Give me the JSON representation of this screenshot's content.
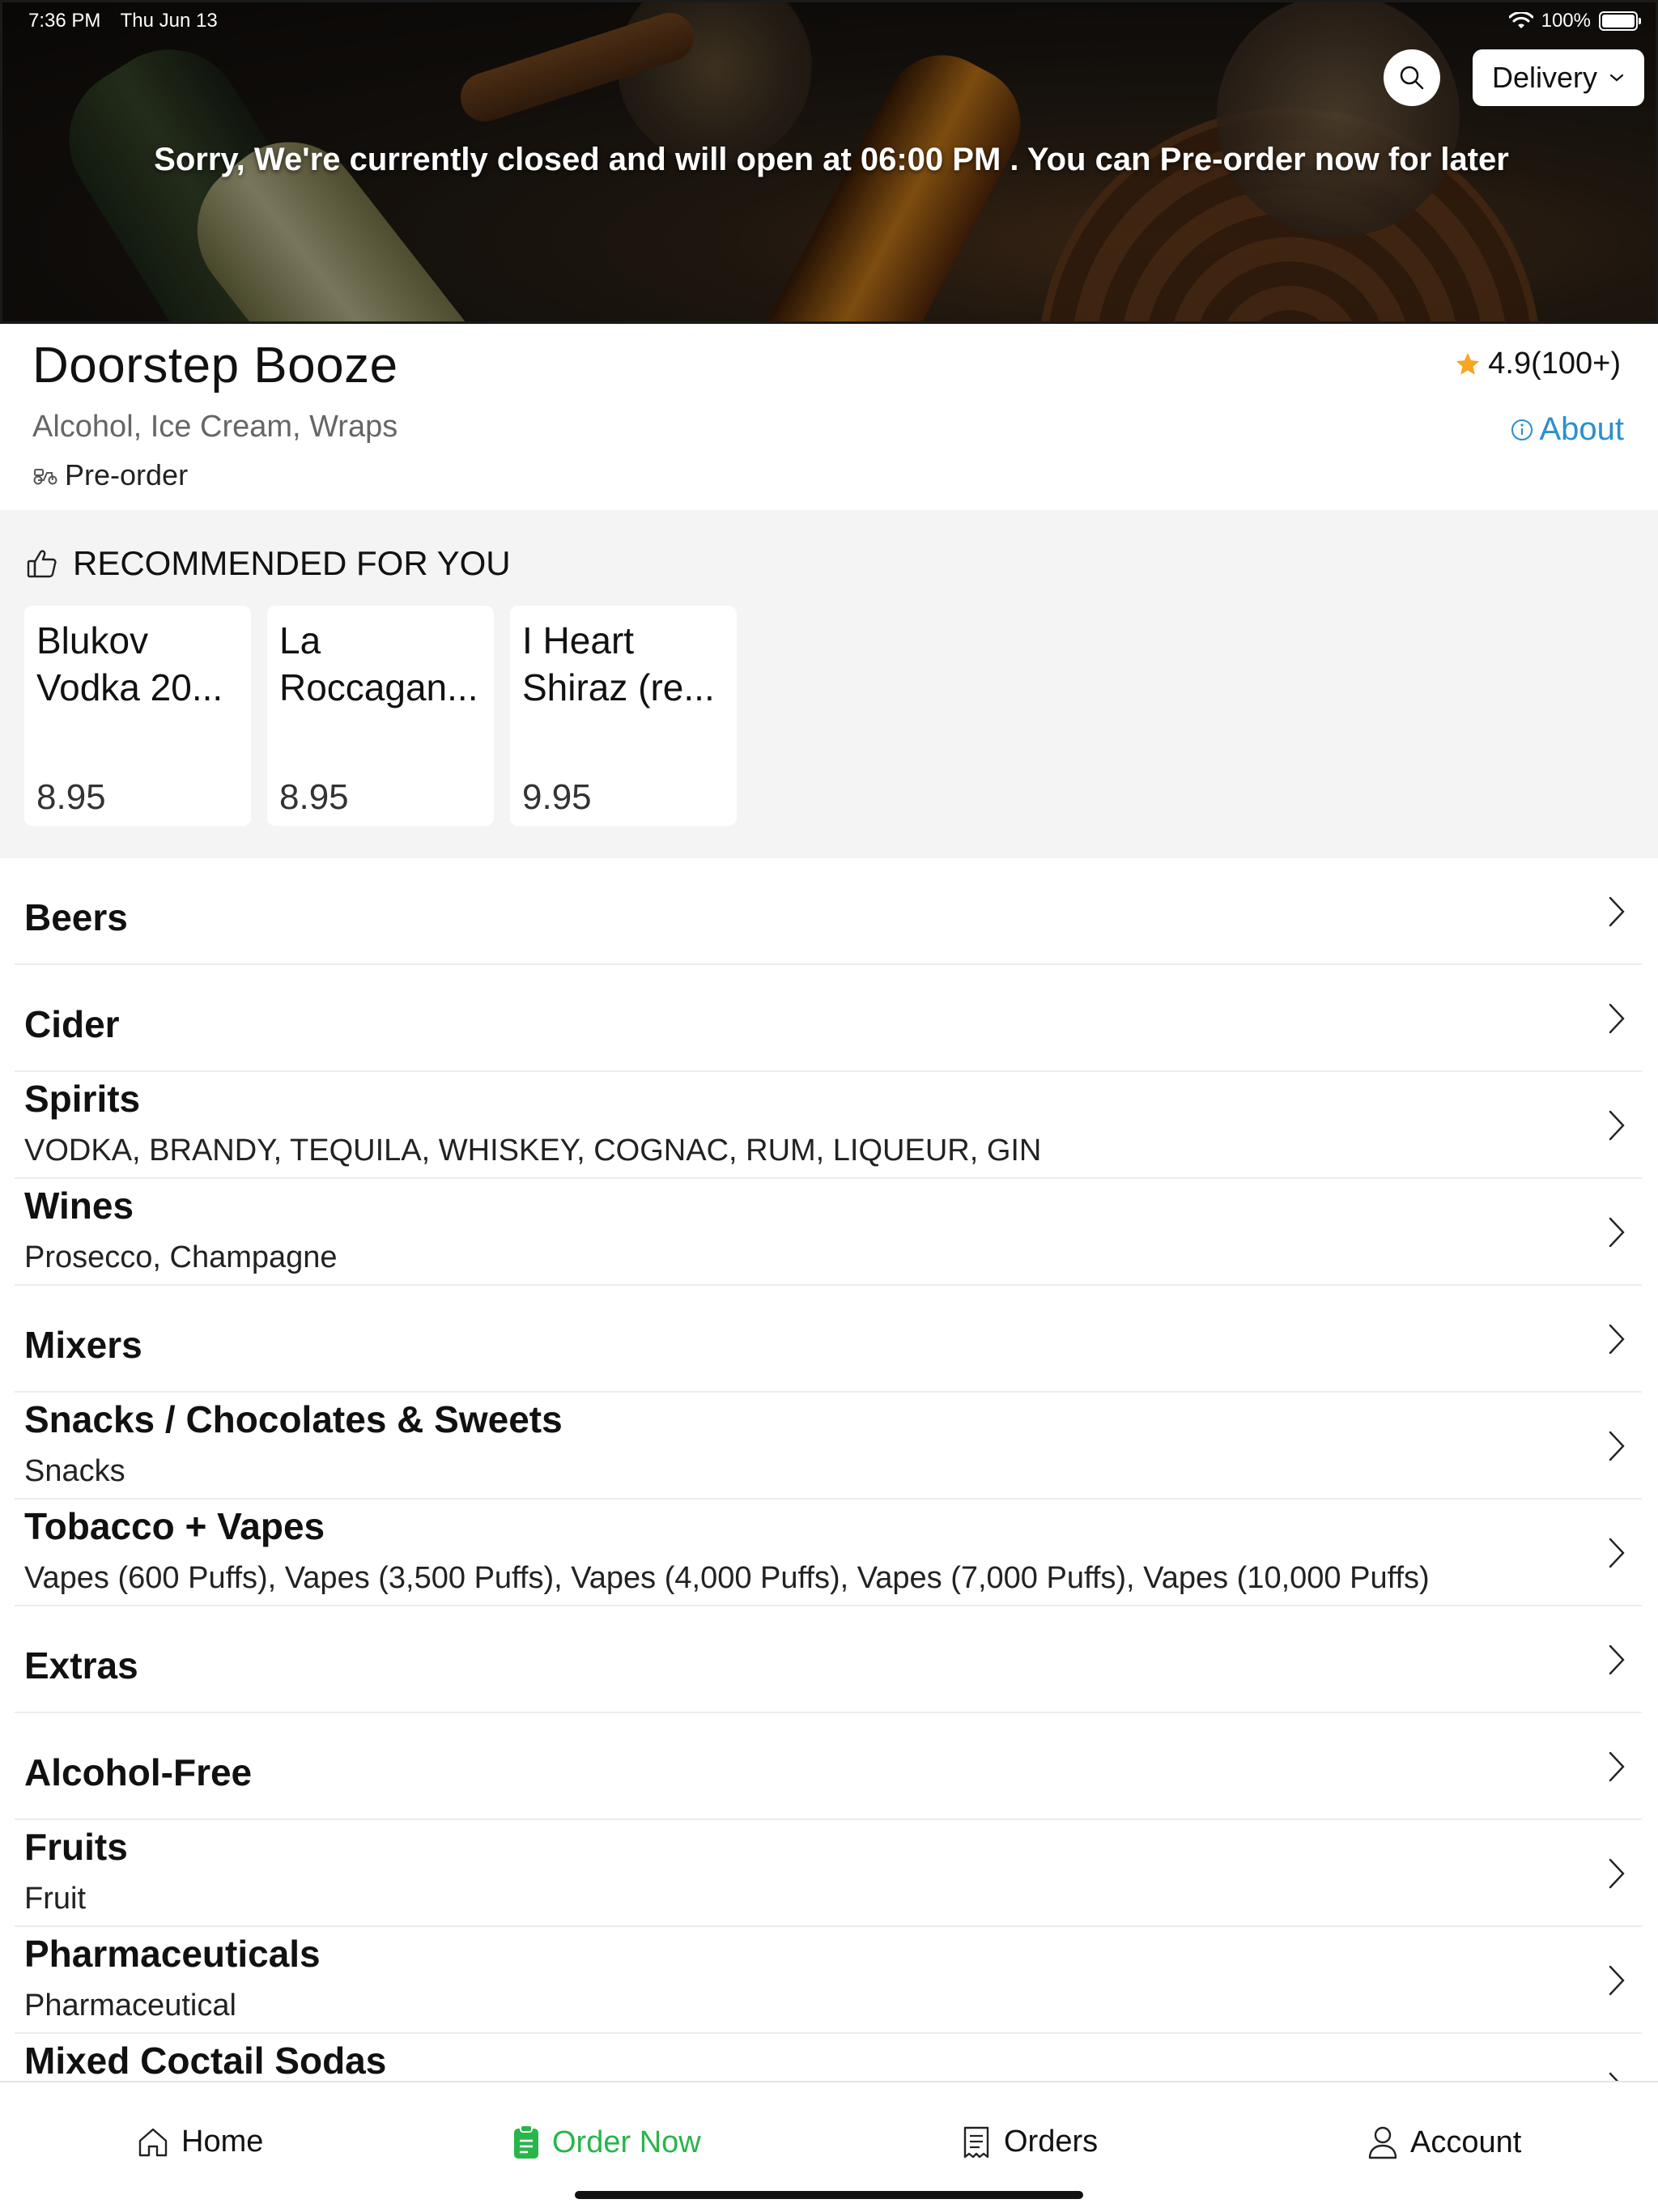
{
  "status_bar": {
    "time": "7:36 PM",
    "date": "Thu Jun 13",
    "battery": "100%"
  },
  "header": {
    "delivery_mode": "Delivery",
    "closed_message": "Sorry, We're currently closed and will open at 06:00 PM . You can Pre-order now for later"
  },
  "store": {
    "name": "Doorstep Booze",
    "tags": "Alcohol, Ice Cream, Wraps",
    "preorder_label": "Pre-order",
    "rating": "4.9(100+)",
    "about_label": "About"
  },
  "recommended": {
    "title": "RECOMMENDED FOR YOU",
    "items": [
      {
        "line1": "Blukov",
        "line2": "Vodka 20...",
        "price": "8.95"
      },
      {
        "line1": "La",
        "line2": "Roccagan...",
        "price": "8.95"
      },
      {
        "line1": "I Heart",
        "line2": "Shiraz (re...",
        "price": "9.95"
      }
    ]
  },
  "categories": [
    {
      "title": "Beers",
      "subtitle": ""
    },
    {
      "title": "Cider",
      "subtitle": ""
    },
    {
      "title": "Spirits",
      "subtitle": "VODKA, BRANDY, TEQUILA, WHISKEY, COGNAC, RUM, LIQUEUR, GIN"
    },
    {
      "title": "Wines",
      "subtitle": "Prosecco, Champagne"
    },
    {
      "title": "Mixers",
      "subtitle": ""
    },
    {
      "title": "Snacks / Chocolates & Sweets",
      "subtitle": "Snacks"
    },
    {
      "title": "Tobacco + Vapes",
      "subtitle": "Vapes (600 Puffs), Vapes (3,500 Puffs), Vapes (4,000 Puffs), Vapes (7,000 Puffs), Vapes (10,000 Puffs)"
    },
    {
      "title": "Extras",
      "subtitle": ""
    },
    {
      "title": "Alcohol-Free",
      "subtitle": ""
    },
    {
      "title": "Fruits",
      "subtitle": "Fruit"
    },
    {
      "title": "Pharmaceuticals",
      "subtitle": "Pharmaceutical"
    },
    {
      "title": "Mixed Coctail Sodas",
      "subtitle": ""
    }
  ],
  "nav": {
    "home": "Home",
    "order_now": "Order Now",
    "orders": "Orders",
    "account": "Account"
  },
  "colors": {
    "accent_green": "#28b54a",
    "link_blue": "#2a8fcf",
    "star": "#f5a623"
  }
}
